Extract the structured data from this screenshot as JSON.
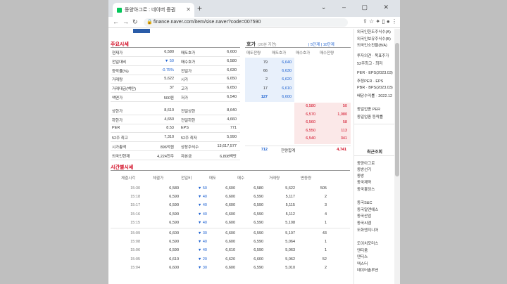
{
  "browser": {
    "tab_title": "동양아그로 : 네이버 증권",
    "url": "finance.naver.com/item/sise.naver?code=007590"
  },
  "summary": {
    "title": "주요시세",
    "rows": [
      [
        "현재가",
        "6,580",
        "매도호가",
        "6,600"
      ],
      [
        "전일대비",
        "▼ 50",
        "매수호가",
        "6,580"
      ],
      [
        "등락률(%)",
        "-0.75%",
        "전일가",
        "6,630"
      ],
      [
        "거래량",
        "5,622",
        "시가",
        "6,650"
      ],
      [
        "거래대금(백만)",
        "37",
        "고가",
        "6,650"
      ],
      [
        "액면가",
        "500원",
        "저가",
        "6,540"
      ],
      [
        "상한가",
        "8,610",
        "전일상한",
        "8,640"
      ],
      [
        "하한가",
        "4,650",
        "전일하한",
        "4,660"
      ],
      [
        "PER",
        "8.53",
        "EPS",
        "771"
      ],
      [
        "52주 최고",
        "7,310",
        "52주 최저",
        "5,990"
      ],
      [
        "시가총액",
        "896억원",
        "상장주식수",
        "13,617,577"
      ],
      [
        "외국인현재",
        "4,224천주",
        "자본금",
        "6,808백만"
      ]
    ]
  },
  "orderbook": {
    "title": "호가",
    "subtitle": "(20분 지연)",
    "links": "| 5단계 | 10단계",
    "headers": [
      "매도잔량",
      "매도호가",
      "매수호가",
      "매수잔량"
    ],
    "asks": [
      [
        "79",
        "6,640"
      ],
      [
        "66",
        "6,630"
      ],
      [
        "2",
        "6,620"
      ],
      [
        "17",
        "6,610"
      ],
      [
        "127",
        "6,600"
      ]
    ],
    "bids": [
      [
        "6,580",
        "50"
      ],
      [
        "6,570",
        "1,080"
      ],
      [
        "6,560",
        "58"
      ],
      [
        "6,550",
        "113"
      ],
      [
        "6,540",
        "341"
      ]
    ],
    "total_ask": "712",
    "total_label": "잔량합계",
    "total_bid": "4,741"
  },
  "timeseries": {
    "title": "시간별시세",
    "headers": [
      "체결시각",
      "체결가",
      "전일비",
      "매도",
      "매수",
      "거래량",
      "변동량"
    ],
    "rows_a": [
      [
        "15:30",
        "6,580",
        "▼ 50",
        "6,600",
        "6,580",
        "5,622",
        "505"
      ],
      [
        "15:18",
        "6,590",
        "▼ 40",
        "6,600",
        "6,590",
        "5,117",
        "2"
      ],
      [
        "15:17",
        "6,590",
        "▼ 40",
        "6,600",
        "6,590",
        "5,115",
        "3"
      ],
      [
        "15:16",
        "6,590",
        "▼ 40",
        "6,600",
        "6,590",
        "5,112",
        "4"
      ],
      [
        "15:15",
        "6,590",
        "▼ 40",
        "6,600",
        "6,590",
        "5,108",
        "1"
      ]
    ],
    "rows_b": [
      [
        "15:09",
        "6,600",
        "▼ 30",
        "6,600",
        "6,590",
        "5,107",
        "43"
      ],
      [
        "15:08",
        "6,590",
        "▼ 40",
        "6,600",
        "6,590",
        "5,064",
        "1"
      ],
      [
        "15:06",
        "6,590",
        "▼ 40",
        "6,610",
        "6,590",
        "5,063",
        "1"
      ],
      [
        "15:05",
        "6,610",
        "▼ 20",
        "6,620",
        "6,600",
        "5,062",
        "52"
      ],
      [
        "15:04",
        "6,600",
        "▼ 30",
        "6,600",
        "6,590",
        "5,010",
        "2"
      ]
    ]
  },
  "sidebar": {
    "top_items": [
      "외국인한도주식수(A)",
      "외국인보유주식수(B)",
      "외국인소진율(B/A)",
      "투자의견 · 목표주가",
      "52주최고 · 최저",
      "PER · EPS(2023.03)",
      "추정PER · EPS",
      "PBR · BPS(2023.03)",
      "배당수익률 · 2022.12",
      "동일업종 PER",
      "동일업종 등락률"
    ],
    "recent_title": "최근조회",
    "recent": [
      "동양아그로",
      "동방선기",
      "동방",
      "동국제약",
      "동국홀딩스",
      "동국S&C",
      "동국알앤에스",
      "동국산업",
      "동국씨엠",
      "도화엔지니어",
      "도이치모터스",
      "덴티움",
      "덴티스",
      "덱스터",
      "데이터솔루션"
    ]
  }
}
